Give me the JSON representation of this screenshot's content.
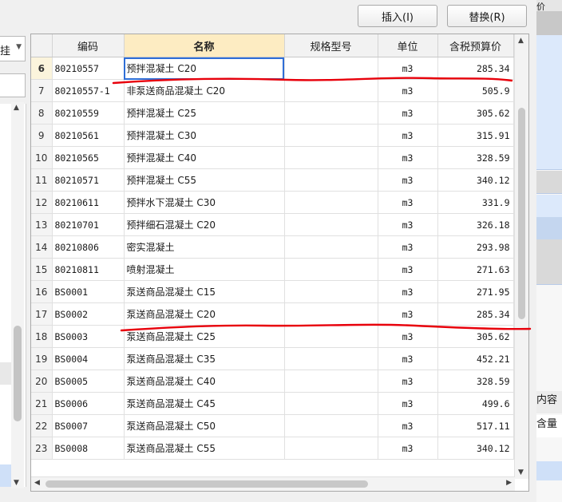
{
  "toolbar": {
    "insert_label": "插入(I)",
    "replace_label": "替换(R)"
  },
  "left_panel": {
    "combo_text": "挂"
  },
  "right_panel": {
    "header_fragment": "价",
    "content_fragment": "内容",
    "amount_fragment": "含量"
  },
  "table": {
    "columns": [
      "",
      "编码",
      "名称",
      "规格型号",
      "单位",
      "含税预算价"
    ],
    "rows": [
      {
        "n": "6",
        "code": "80210557",
        "name": "预拌混凝土 C20",
        "spec": "",
        "unit": "m3",
        "price": "285.34"
      },
      {
        "n": "7",
        "code": "80210557-1",
        "name": "非泵送商品混凝土 C20",
        "spec": "",
        "unit": "m3",
        "price": "505.9"
      },
      {
        "n": "8",
        "code": "80210559",
        "name": "预拌混凝土 C25",
        "spec": "",
        "unit": "m3",
        "price": "305.62"
      },
      {
        "n": "9",
        "code": "80210561",
        "name": "预拌混凝土 C30",
        "spec": "",
        "unit": "m3",
        "price": "315.91"
      },
      {
        "n": "10",
        "code": "80210565",
        "name": "预拌混凝土 C40",
        "spec": "",
        "unit": "m3",
        "price": "328.59"
      },
      {
        "n": "11",
        "code": "80210571",
        "name": "预拌混凝土 C55",
        "spec": "",
        "unit": "m3",
        "price": "340.12"
      },
      {
        "n": "12",
        "code": "80210611",
        "name": "预拌水下混凝土 C30",
        "spec": "",
        "unit": "m3",
        "price": "331.9"
      },
      {
        "n": "13",
        "code": "80210701",
        "name": "预拌细石混凝土 C20",
        "spec": "",
        "unit": "m3",
        "price": "326.18"
      },
      {
        "n": "14",
        "code": "80210806",
        "name": "密实混凝土",
        "spec": "",
        "unit": "m3",
        "price": "293.98"
      },
      {
        "n": "15",
        "code": "80210811",
        "name": "喷射混凝土",
        "spec": "",
        "unit": "m3",
        "price": "271.63"
      },
      {
        "n": "16",
        "code": "BS0001",
        "name": "泵送商品混凝土 C15",
        "spec": "",
        "unit": "m3",
        "price": "271.95"
      },
      {
        "n": "17",
        "code": "BS0002",
        "name": "泵送商品混凝土 C20",
        "spec": "",
        "unit": "m3",
        "price": "285.34"
      },
      {
        "n": "18",
        "code": "BS0003",
        "name": "泵送商品混凝土 C25",
        "spec": "",
        "unit": "m3",
        "price": "305.62"
      },
      {
        "n": "19",
        "code": "BS0004",
        "name": "泵送商品混凝土 C35",
        "spec": "",
        "unit": "m3",
        "price": "452.21"
      },
      {
        "n": "20",
        "code": "BS0005",
        "name": "泵送商品混凝土 C40",
        "spec": "",
        "unit": "m3",
        "price": "328.59"
      },
      {
        "n": "21",
        "code": "BS0006",
        "name": "泵送商品混凝土 C45",
        "spec": "",
        "unit": "m3",
        "price": "499.6"
      },
      {
        "n": "22",
        "code": "BS0007",
        "name": "泵送商品混凝土 C50",
        "spec": "",
        "unit": "m3",
        "price": "517.11"
      },
      {
        "n": "23",
        "code": "BS0008",
        "name": "泵送商品混凝土 C55",
        "spec": "",
        "unit": "m3",
        "price": "340.12"
      }
    ]
  },
  "colors": {
    "annotation": "#e8000b",
    "selection": "#2f6ed6",
    "header_highlight": "#fdecc2"
  }
}
